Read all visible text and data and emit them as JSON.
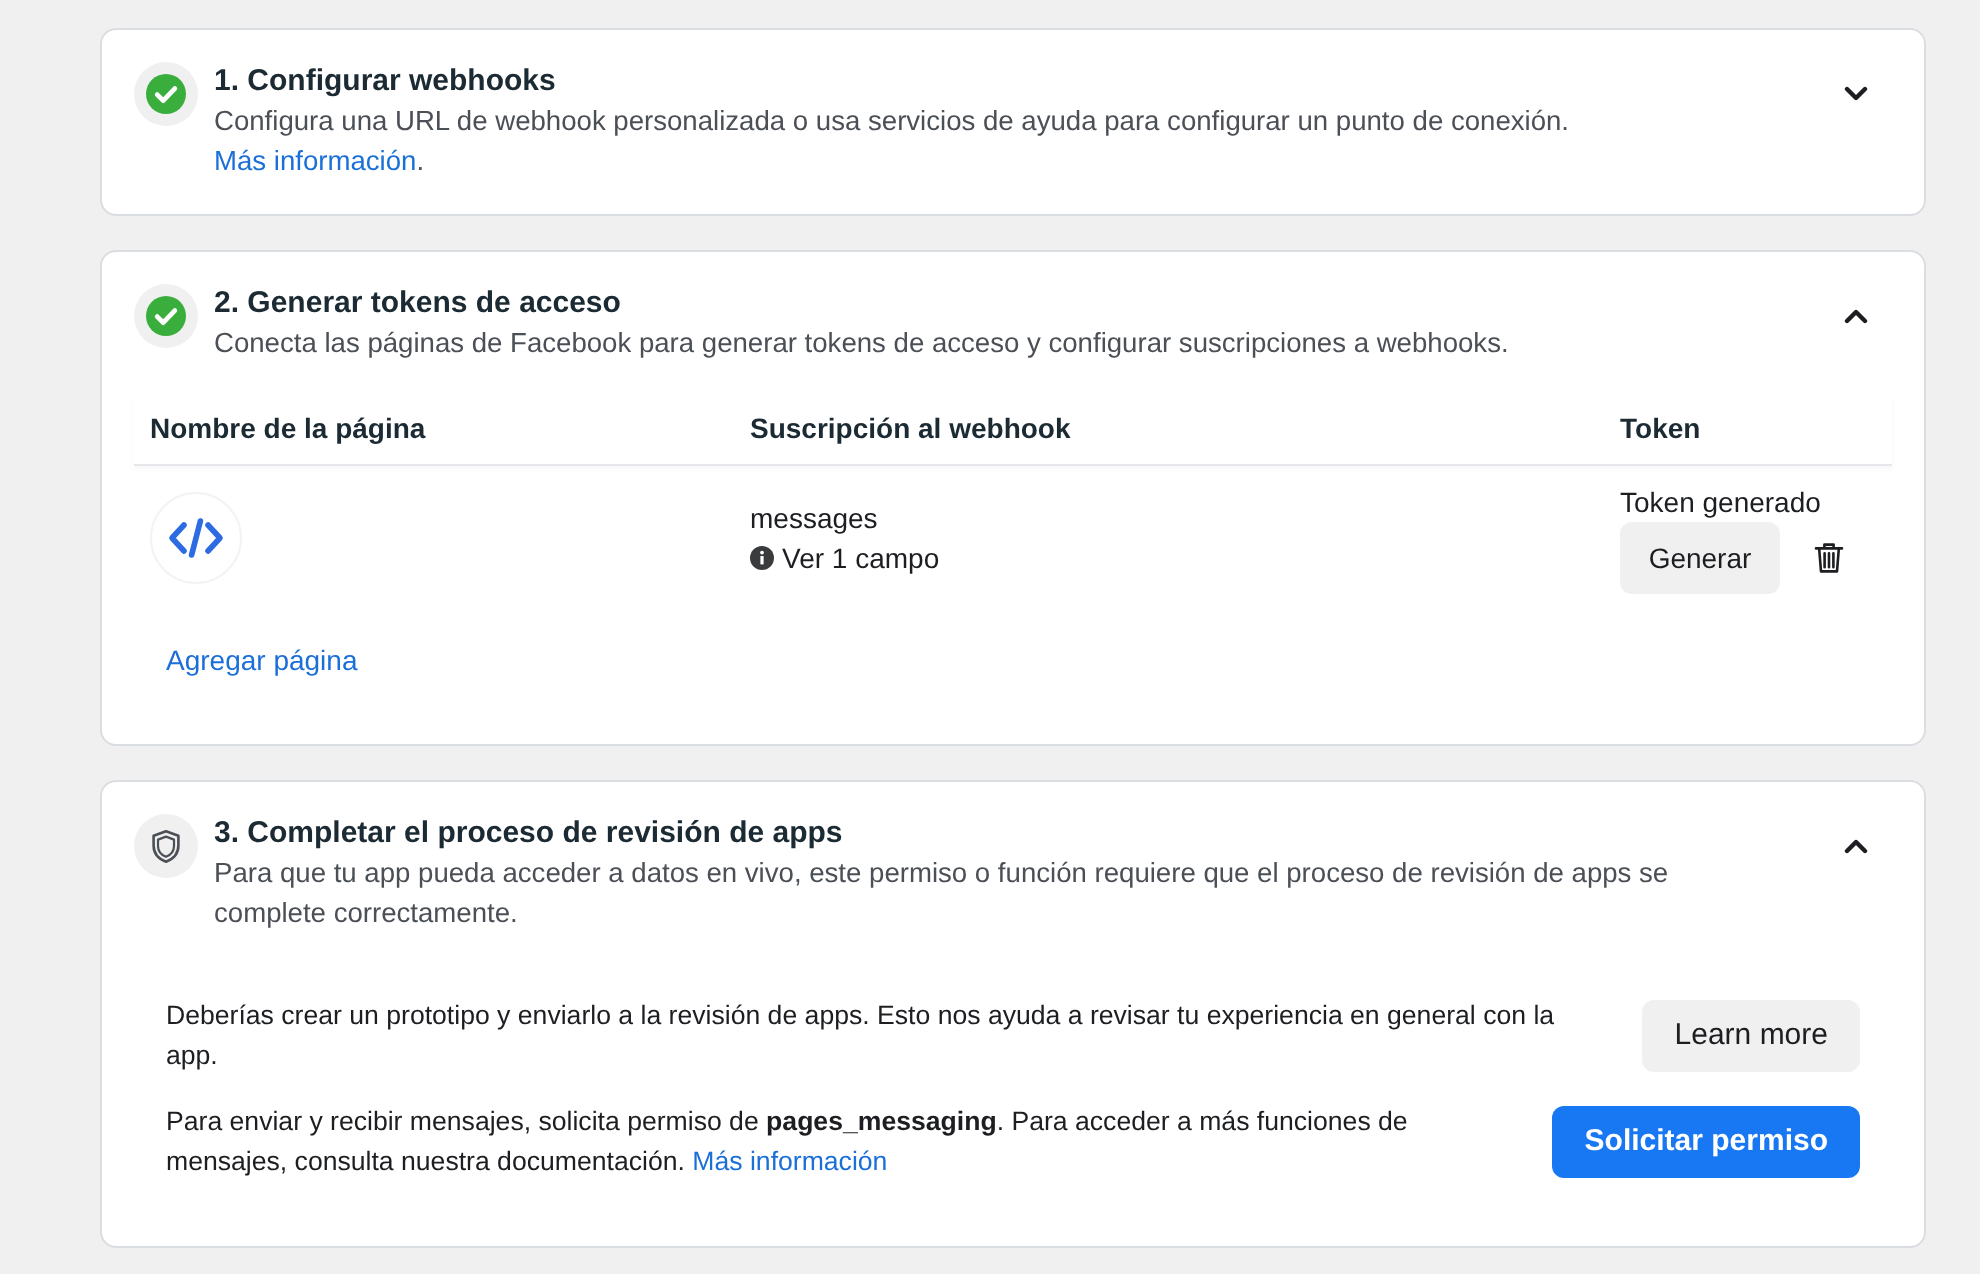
{
  "steps": [
    {
      "completed": true,
      "expanded": false,
      "title": "1. Configurar webhooks",
      "description": "Configura una URL de webhook personalizada o usa servicios de ayuda para configurar un punto de conexión.",
      "link": "Más información",
      "after": "."
    },
    {
      "completed": true,
      "expanded": true,
      "title": "2. Generar tokens de acceso",
      "description": "Conecta las páginas de Facebook para generar tokens de acceso y configurar suscripciones a webhooks.",
      "table": {
        "columns": [
          "Nombre de la página",
          "Suscripción al webhook",
          "Token"
        ],
        "rows": [
          {
            "subscription": "messages",
            "fields_link": "Ver 1 campo",
            "token_status": "Token generado",
            "action": "Generar"
          }
        ]
      },
      "add_link": "Agregar página"
    },
    {
      "completed": false,
      "expanded": true,
      "title": "3. Completar el proceso de revisión de apps",
      "description": "Para que tu app pueda acceder a datos en vivo, este permiso o función requiere que el proceso de revisión de apps se complete correctamente.",
      "items": [
        {
          "text": "Deberías crear un prototipo y enviarlo a la revisión de apps. Esto nos ayuda a revisar tu experiencia en general con la app.",
          "button": {
            "label": "Learn more",
            "kind": "secondary"
          }
        },
        {
          "text": "Para enviar y recibir mensajes, solicita permiso de **pages_messaging**. Para acceder a más funciones de mensajes, consulta nuestra documentación.",
          "link": "Más información",
          "button": {
            "label": "Solicitar permiso",
            "kind": "primary"
          }
        }
      ]
    }
  ]
}
